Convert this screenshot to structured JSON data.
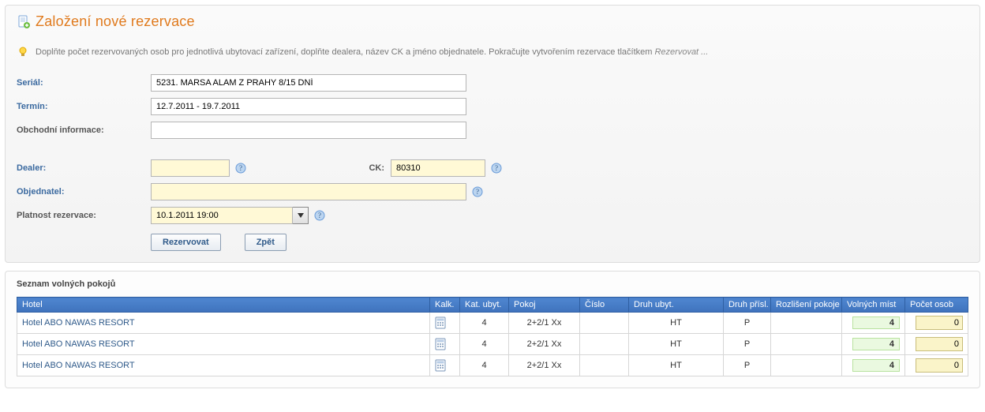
{
  "header": {
    "title": "Založení nové rezervace",
    "hint_prefix": "Doplňte počet rezervovaných osob pro jednotlivá ubytovací zařízení, doplňte dealera, název CK a jméno objednatele. Pokračujte vytvořením rezervace tlačítkem ",
    "hint_em": "Rezervovat ..."
  },
  "form": {
    "labels": {
      "serial": "Seriál:",
      "termin": "Termín:",
      "obch_info": "Obchodní informace:",
      "dealer": "Dealer:",
      "ck": "CK:",
      "objednatel": "Objednatel:",
      "platnost": "Platnost rezervace:"
    },
    "values": {
      "serial": "5231. MARSA ALAM Z PRAHY 8/15 DNÍ",
      "termin": "12.7.2011 - 19.7.2011",
      "obch_info": "",
      "dealer": "",
      "ck": "80310",
      "objednatel": "",
      "platnost": "10.1.2011 19:00"
    },
    "buttons": {
      "rezervovat": "Rezervovat",
      "zpet": "Zpět"
    }
  },
  "rooms": {
    "section_title": "Seznam volných pokojů",
    "columns": {
      "hotel": "Hotel",
      "kalk": "Kalk.",
      "kat": "Kat. ubyt.",
      "pokoj": "Pokoj",
      "cislo": "Číslo",
      "druh_ubyt": "Druh ubyt.",
      "druh_prisl": "Druh přísl.",
      "rozliseni": "Rozlišení pokoje",
      "volnych": "Volných míst",
      "osob": "Počet osob"
    },
    "rows": [
      {
        "hotel": "Hotel ABO NAWAS RESORT",
        "kat": "4",
        "pokoj": "2+2/1 Xx",
        "cislo": "",
        "druh_ubyt": "HT",
        "druh_prisl": "P",
        "rozliseni": "",
        "volnych": "4",
        "osob": "0"
      },
      {
        "hotel": "Hotel ABO NAWAS RESORT",
        "kat": "4",
        "pokoj": "2+2/1 Xx",
        "cislo": "",
        "druh_ubyt": "HT",
        "druh_prisl": "P",
        "rozliseni": "",
        "volnych": "4",
        "osob": "0"
      },
      {
        "hotel": "Hotel ABO NAWAS RESORT",
        "kat": "4",
        "pokoj": "2+2/1 Xx",
        "cislo": "",
        "druh_ubyt": "HT",
        "druh_prisl": "P",
        "rozliseni": "",
        "volnych": "4",
        "osob": "0"
      }
    ]
  }
}
